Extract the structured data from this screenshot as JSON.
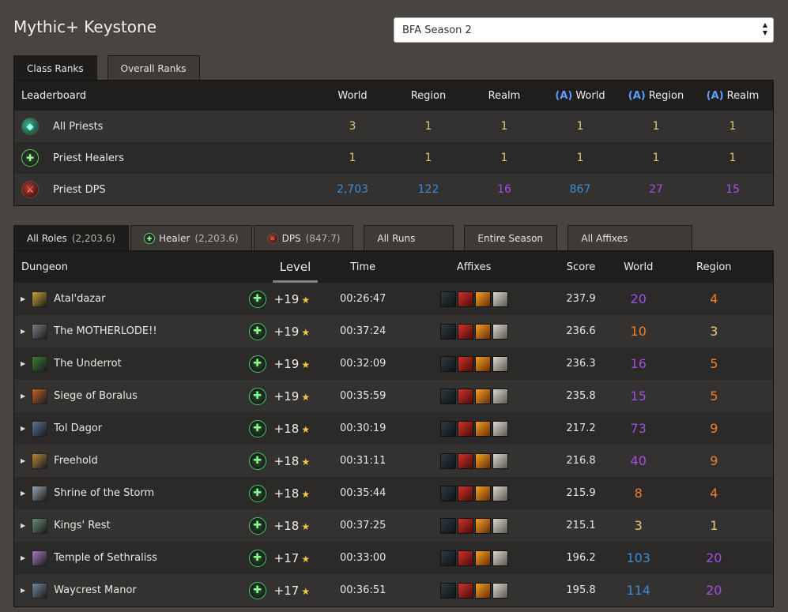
{
  "page_title": "Mythic+ Keystone",
  "season_select": {
    "value": "BFA Season 2"
  },
  "rank_tabs": [
    "Class Ranks",
    "Overall Ranks"
  ],
  "ranks": {
    "headers": [
      "Leaderboard",
      "World",
      "Region",
      "Realm",
      "World",
      "Region",
      "Realm"
    ],
    "alliance_prefix": "(A)",
    "rows": [
      {
        "name": "All Priests",
        "icon": "all-priests-icon",
        "values": [
          "3",
          "1",
          "1",
          "1",
          "1",
          "1"
        ]
      },
      {
        "name": "Priest Healers",
        "icon": "healer-icon",
        "values": [
          "1",
          "1",
          "1",
          "1",
          "1",
          "1"
        ]
      },
      {
        "name": "Priest DPS",
        "icon": "dps-icon",
        "values": [
          "2,703",
          "122",
          "16",
          "867",
          "27",
          "15"
        ]
      }
    ]
  },
  "role_tabs": [
    {
      "label": "All Roles",
      "count": "(2,203.6)"
    },
    {
      "label": "Healer",
      "count": "(2,203.6)"
    },
    {
      "label": "DPS",
      "count": "(847.7)"
    }
  ],
  "filter_tabs": [
    "All Runs",
    "Entire Season",
    "All Affixes"
  ],
  "runs": {
    "headers": {
      "dungeon": "Dungeon",
      "level": "Level",
      "time": "Time",
      "affixes": "Affixes",
      "score": "Score",
      "world": "World",
      "region": "Region"
    },
    "rows": [
      {
        "dungeon": "Atal'dazar",
        "level": "+19",
        "time": "00:26:47",
        "score": "237.9",
        "world": "20",
        "region": "4",
        "icon_color": "#c9a43a"
      },
      {
        "dungeon": "The MOTHERLODE!!",
        "level": "+19",
        "time": "00:37:24",
        "score": "236.6",
        "world": "10",
        "region": "3",
        "icon_color": "#7a7f88"
      },
      {
        "dungeon": "The Underrot",
        "level": "+19",
        "time": "00:32:09",
        "score": "236.3",
        "world": "16",
        "region": "5",
        "icon_color": "#3e7d3a"
      },
      {
        "dungeon": "Siege of Boralus",
        "level": "+19",
        "time": "00:35:59",
        "score": "235.8",
        "world": "15",
        "region": "5",
        "icon_color": "#c4622a"
      },
      {
        "dungeon": "Tol Dagor",
        "level": "+18",
        "time": "00:30:19",
        "score": "217.2",
        "world": "73",
        "region": "9",
        "icon_color": "#5c7694"
      },
      {
        "dungeon": "Freehold",
        "level": "+18",
        "time": "00:31:11",
        "score": "216.8",
        "world": "40",
        "region": "9",
        "icon_color": "#b88a3c"
      },
      {
        "dungeon": "Shrine of the Storm",
        "level": "+18",
        "time": "00:35:44",
        "score": "215.9",
        "world": "8",
        "region": "4",
        "icon_color": "#9aa6b4"
      },
      {
        "dungeon": "Kings' Rest",
        "level": "+18",
        "time": "00:37:25",
        "score": "215.1",
        "world": "3",
        "region": "1",
        "icon_color": "#6b8e7a"
      },
      {
        "dungeon": "Temple of Sethraliss",
        "level": "+17",
        "time": "00:33:00",
        "score": "196.2",
        "world": "103",
        "region": "20",
        "icon_color": "#a67cc4"
      },
      {
        "dungeon": "Waycrest Manor",
        "level": "+17",
        "time": "00:36:51",
        "score": "195.8",
        "world": "114",
        "region": "20",
        "icon_color": "#6f8aa1"
      }
    ]
  },
  "colors": {
    "gold": "#e2c77e",
    "blue": "#3a8bd9",
    "purple": "#a34ee3",
    "orange": "#f07f27",
    "tan": "#e8c67a"
  }
}
